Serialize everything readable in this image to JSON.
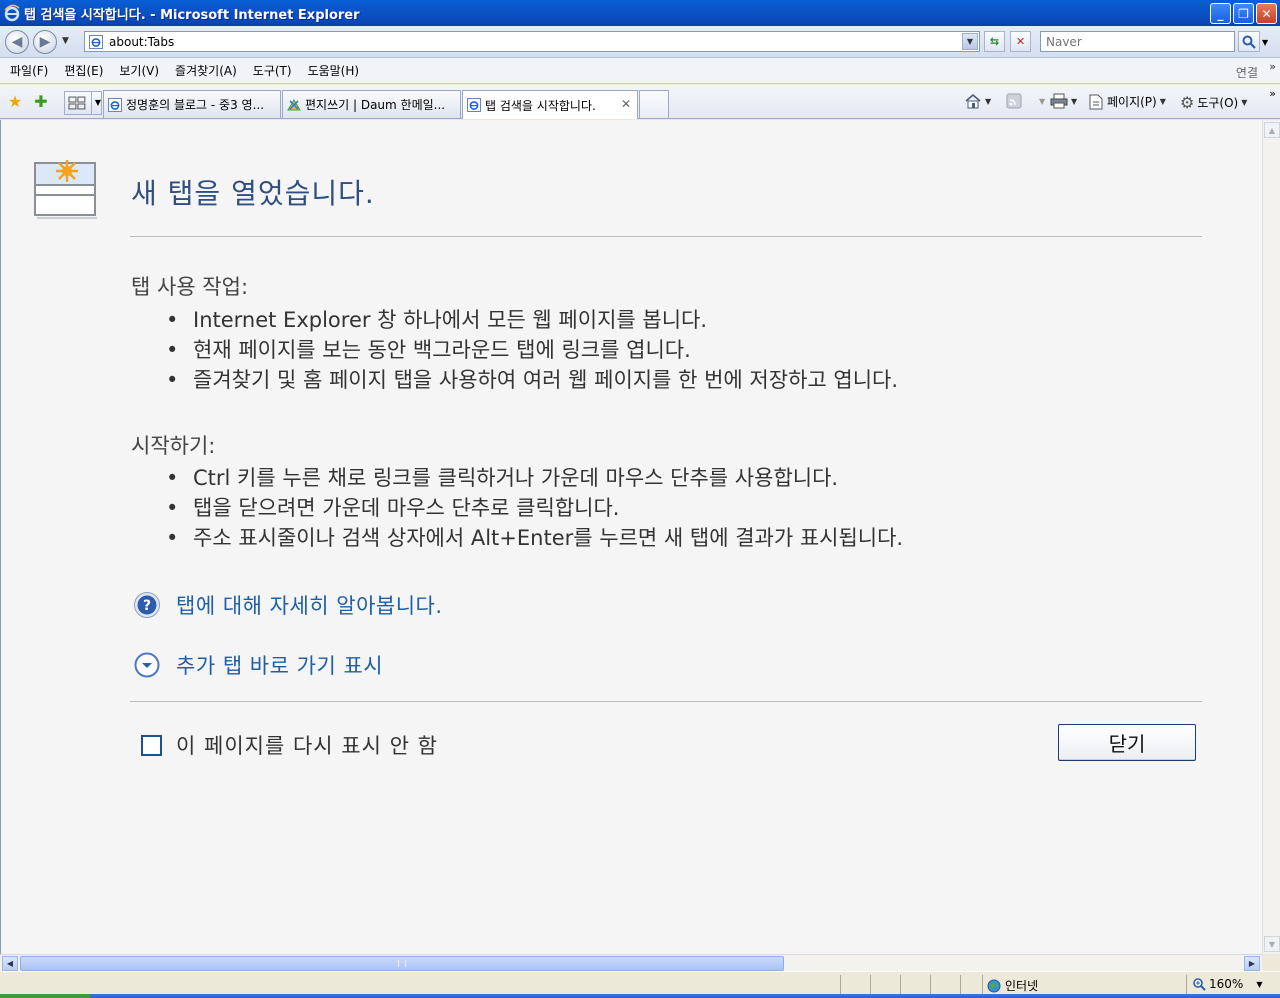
{
  "window": {
    "title": "탭 검색을 시작합니다. - Microsoft Internet Explorer"
  },
  "address_bar": {
    "url": "about:Tabs",
    "search_placeholder": "Naver"
  },
  "menu": {
    "items": [
      "파일(F)",
      "편집(E)",
      "보기(V)",
      "즐겨찾기(A)",
      "도구(T)",
      "도움말(H)"
    ],
    "right_label": "연결"
  },
  "tabs": [
    {
      "label": "정명훈의 블로그 - 중3 영...",
      "icon": "blog-icon"
    },
    {
      "label": "편지쓰기 | Daum 한메일...",
      "icon": "mail-icon"
    },
    {
      "label": "탭 검색을 시작합니다.",
      "icon": "ie-page-icon",
      "active": true
    }
  ],
  "command_bar": {
    "page_label": "페이지(P)",
    "tools_label": "도구(O)"
  },
  "page": {
    "headline": "새 탭을 열었습니다.",
    "section1_title": "탭 사용 작업:",
    "section1_items": [
      "Internet Explorer 창 하나에서 모든 웹 페이지를 봅니다.",
      "현재 페이지를 보는 동안 백그라운드 탭에 링크를 엽니다.",
      "즐겨찾기 및 홈 페이지 탭을 사용하여 여러 웹 페이지를 한 번에 저장하고 엽니다."
    ],
    "section2_title": "시작하기:",
    "section2_items": [
      "Ctrl 키를 누른 채로 링크를 클릭하거나 가운데 마우스 단추를 사용합니다.",
      "탭을 닫으려면 가운데 마우스 단추로 클릭합니다.",
      "주소 표시줄이나 검색 상자에서 Alt+Enter를 누르면 새 탭에 결과가 표시됩니다."
    ],
    "learn_more_link": "탭에 대해 자세히 알아봅니다.",
    "more_shortcuts_link": "추가 탭 바로 가기 표시",
    "dont_show_label": "이 페이지를 다시 표시 안 함",
    "dont_show_checked": false,
    "close_button": "닫기"
  },
  "status_bar": {
    "zone": "인터넷",
    "zoom": "160%"
  },
  "colors": {
    "titlebar": "#0a52c8",
    "headline": "#2f4f80",
    "link": "#1e5fa8",
    "content_bg": "#f5f5f5"
  }
}
